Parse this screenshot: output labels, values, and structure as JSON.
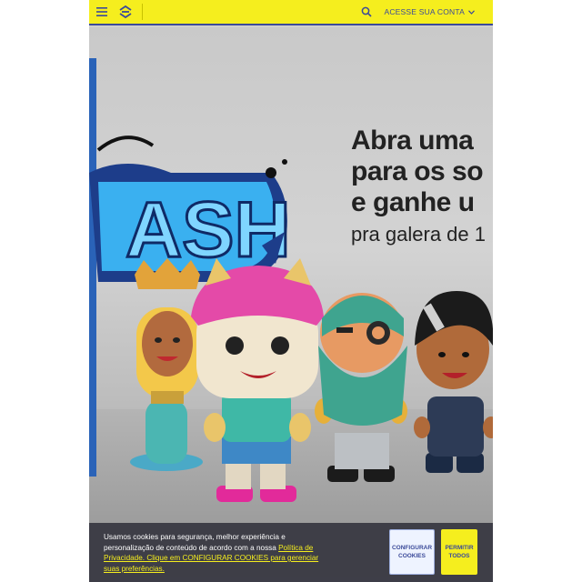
{
  "header": {
    "menu_icon": "hamburger-menu-icon",
    "logo_icon": "bank-logo-icon",
    "search_icon": "search-icon",
    "account_label": "ACESSE SUA CONTA",
    "account_chevron": "chevron-down-icon",
    "background": "#f5ee1e",
    "accent": "#3b4a99"
  },
  "hero": {
    "promo_line1": "Abra uma",
    "promo_line2": "para os so",
    "promo_line3": "e ganhe u",
    "promo_sub": "pra galera de 1",
    "graffiti_text": "ASH"
  },
  "cookie_banner": {
    "text_before_link": "Usamos cookies para segurança, melhor experiência e personalização de conteúdo de acordo com a nossa ",
    "link_text": "Política de Privacidade. Clique em CONFIGURAR COOKIES para gerenciar suas preferências.",
    "configure_label": "CONFIGURAR COOKIES",
    "allow_label": "PERMITIR TODOS"
  }
}
